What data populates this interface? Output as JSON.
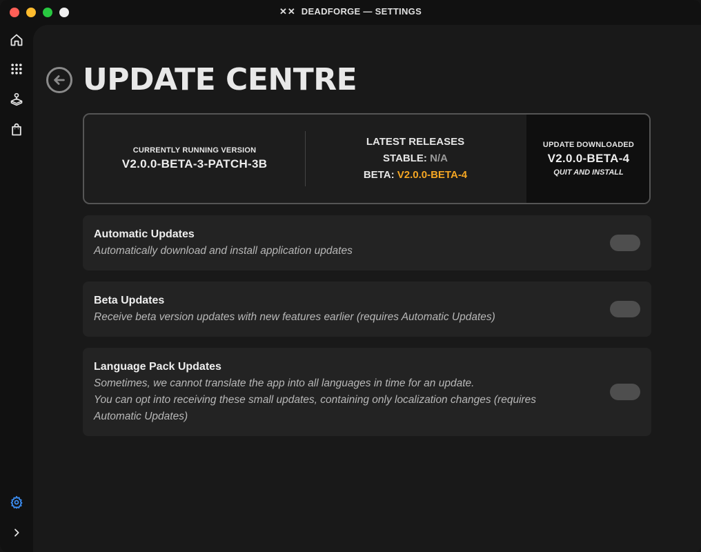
{
  "window": {
    "title": "DEADFORGE — SETTINGS",
    "logo_text": "✕✕"
  },
  "sidebar": {
    "items": [
      {
        "name": "home",
        "icon": "home-icon"
      },
      {
        "name": "library",
        "icon": "grid-icon"
      },
      {
        "name": "game-tools",
        "icon": "joystick-icon"
      },
      {
        "name": "store",
        "icon": "bag-icon"
      }
    ],
    "settings_icon": "gear-icon",
    "settings_color": "#3b8cf0",
    "expand_icon": "chevron-right-icon"
  },
  "page": {
    "title": "UPDATE CENTRE",
    "back_icon": "arrow-left-icon"
  },
  "version_card": {
    "current_label": "CURRENTLY RUNNING VERSION",
    "current_version": "V2.0.0-BETA-3-PATCH-3B",
    "latest_label": "LATEST RELEASES",
    "stable_label": "STABLE:",
    "stable_value": "N/A",
    "beta_label": "BETA:",
    "beta_value": "V2.0.0-BETA-4",
    "downloaded_label": "UPDATE DOWNLOADED",
    "downloaded_version": "V2.0.0-BETA-4",
    "install_label": "QUIT AND INSTALL",
    "accent_color": "#f5a623"
  },
  "settings": [
    {
      "title": "Automatic Updates",
      "description": [
        "Automatically download and install application updates"
      ],
      "enabled": false
    },
    {
      "title": "Beta Updates",
      "description": [
        "Receive beta version updates with new features earlier (requires Automatic Updates)"
      ],
      "enabled": false
    },
    {
      "title": "Language Pack Updates",
      "description": [
        "Sometimes, we cannot translate the app into all languages in time for an update.",
        "You can opt into receiving these small updates, containing only localization changes (requires Automatic Updates)"
      ],
      "enabled": false
    }
  ]
}
